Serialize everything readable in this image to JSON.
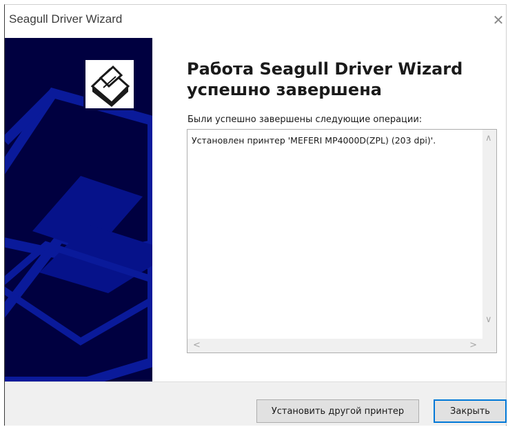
{
  "window": {
    "title": "Seagull Driver Wizard",
    "close_glyph": "✕"
  },
  "main": {
    "heading_line1": "Работа Seagull Driver Wizard",
    "heading_line2": "успешно завершена",
    "subtitle": "Были успешно завершены следующие операции:",
    "list_items": [
      "Установлен принтер 'MEFERI MP4000D(ZPL) (203 dpi)'."
    ]
  },
  "buttons": {
    "install_other": "Установить другой принтер",
    "close": "Закрыть"
  },
  "colors": {
    "side_panel": "#000040",
    "side_art": "#0a1a9a",
    "default_button_border": "#0078d7"
  },
  "icons": {
    "logo": "printer-logo-icon",
    "close": "close-icon",
    "scroll_up": "chevron-up-icon",
    "scroll_down": "chevron-down-icon",
    "scroll_left": "chevron-left-icon",
    "scroll_right": "chevron-right-icon"
  }
}
